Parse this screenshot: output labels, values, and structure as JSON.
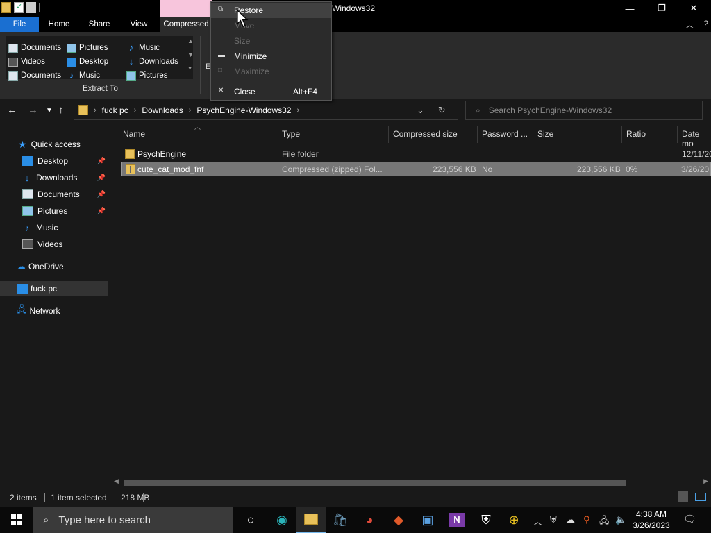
{
  "titlebar": {
    "window_title": "Windows32",
    "minimize": "—",
    "restore": "❐",
    "close": "✕"
  },
  "ribbon": {
    "tabs": {
      "file": "File",
      "home": "Home",
      "share": "Share",
      "view": "View",
      "compressed": "Compressed"
    },
    "extract_to_items": [
      {
        "label": "Documents",
        "icon": "document-icon"
      },
      {
        "label": "Pictures",
        "icon": "pictures-icon"
      },
      {
        "label": "Music",
        "icon": "music-icon"
      },
      {
        "label": "Videos",
        "icon": "videos-icon"
      },
      {
        "label": "Desktop",
        "icon": "desktop-icon"
      },
      {
        "label": "Downloads",
        "icon": "downloads-icon"
      },
      {
        "label": "Documents",
        "icon": "document-icon"
      },
      {
        "label": "Music",
        "icon": "music-icon"
      },
      {
        "label": "Pictures",
        "icon": "pictures-icon"
      }
    ],
    "group_label": "Extract To",
    "extract_all_fragment": "E"
  },
  "address": {
    "crumbs": [
      "fuck pc",
      "Downloads",
      "PsychEngine-Windows32"
    ],
    "search_placeholder": "Search PsychEngine-Windows32"
  },
  "navpane": {
    "quick_access": "Quick access",
    "items": [
      {
        "label": "Desktop",
        "pinned": true
      },
      {
        "label": "Downloads",
        "pinned": true
      },
      {
        "label": "Documents",
        "pinned": true
      },
      {
        "label": "Pictures",
        "pinned": true
      },
      {
        "label": "Music",
        "pinned": false
      },
      {
        "label": "Videos",
        "pinned": false
      }
    ],
    "onedrive": "OneDrive",
    "this_pc": "fuck pc",
    "network": "Network"
  },
  "columns": [
    "Name",
    "Type",
    "Compressed size",
    "Password ...",
    "Size",
    "Ratio",
    "Date mo"
  ],
  "files": [
    {
      "name": "PsychEngine",
      "type": "File folder",
      "compressed": "",
      "password": "",
      "size": "",
      "ratio": "",
      "date": "12/11/20"
    },
    {
      "name": "cute_cat_mod_fnf",
      "type": "Compressed (zipped) Fol...",
      "compressed": "223,556 KB",
      "password": "No",
      "size": "223,556 KB",
      "ratio": "0%",
      "date": "3/26/20"
    }
  ],
  "status": {
    "items": "2 items",
    "selected": "1 item selected",
    "size": "218 MB"
  },
  "context_menu": {
    "restore": "Restore",
    "move": "Move",
    "size": "Size",
    "minimize": "Minimize",
    "maximize": "Maximize",
    "close": "Close",
    "close_shortcut": "Alt+F4"
  },
  "taskbar": {
    "search_placeholder": "Type here to search",
    "time": "4:38 AM",
    "date": "3/26/2023"
  },
  "colors": {
    "accent": "#1a6fd1",
    "context_tab": "#f7c5dc",
    "folder": "#e8c15a"
  }
}
